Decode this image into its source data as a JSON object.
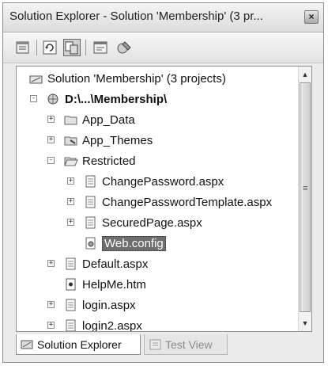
{
  "window": {
    "title": "Solution Explorer - Solution 'Membership' (3 pr...",
    "close_glyph": "×"
  },
  "toolbar": {
    "buttons": [
      {
        "name": "properties-icon"
      },
      {
        "name": "refresh-icon"
      },
      {
        "name": "show-all-files-icon"
      },
      {
        "name": "view-code-icon"
      },
      {
        "name": "asp-net-configuration-icon"
      }
    ]
  },
  "tree": {
    "items": [
      {
        "label": "Solution 'Membership' (3 projects)",
        "icon": "solution-icon",
        "expander": "none"
      },
      {
        "label": "D:\\...\\Membership\\",
        "icon": "website-project-icon",
        "expander": "-"
      },
      {
        "label": "App_Data",
        "icon": "folder-icon",
        "expander": "+"
      },
      {
        "label": "App_Themes",
        "icon": "themes-folder-icon",
        "expander": "+"
      },
      {
        "label": "Restricted",
        "icon": "open-folder-icon",
        "expander": "-"
      },
      {
        "label": "ChangePassword.aspx",
        "icon": "aspx-file-icon",
        "expander": "+"
      },
      {
        "label": "ChangePasswordTemplate.aspx",
        "icon": "aspx-file-icon",
        "expander": "+"
      },
      {
        "label": "SecuredPage.aspx",
        "icon": "aspx-file-icon",
        "expander": "+"
      },
      {
        "label": "Web.config",
        "icon": "config-file-icon",
        "expander": "none"
      },
      {
        "label": "Default.aspx",
        "icon": "aspx-file-icon",
        "expander": "+"
      },
      {
        "label": "HelpMe.htm",
        "icon": "html-file-icon",
        "expander": "none"
      },
      {
        "label": "login.aspx",
        "icon": "aspx-file-icon",
        "expander": "+"
      },
      {
        "label": "login2.aspx",
        "icon": "aspx-file-icon",
        "expander": "+"
      }
    ],
    "selected": "Web.config"
  },
  "tabs": [
    {
      "label": "Solution Explorer",
      "active": true
    },
    {
      "label": "Test View",
      "active": false
    }
  ],
  "scrollbar": {
    "up": "▲",
    "down": "▼",
    "grip": "≡"
  }
}
